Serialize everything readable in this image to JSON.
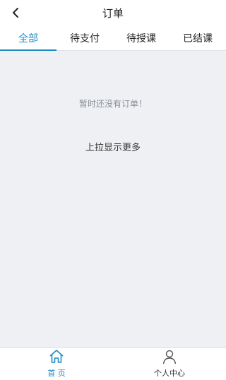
{
  "header": {
    "title": "订单",
    "back_icon": "chevron-left-icon"
  },
  "tabs": [
    {
      "label": "全部",
      "active": true
    },
    {
      "label": "待支付",
      "active": false
    },
    {
      "label": "待授课",
      "active": false
    },
    {
      "label": "已结课",
      "active": false
    }
  ],
  "main": {
    "empty_text": "暂时还没有订单！",
    "load_more_text": "上拉显示更多"
  },
  "tabbar": {
    "items": [
      {
        "label": "首 页",
        "icon": "home-icon",
        "active": true
      },
      {
        "label": "个人中心",
        "icon": "user-icon",
        "active": false
      }
    ]
  },
  "colors": {
    "accent": "#1e8bc3",
    "background": "#eef0f3"
  }
}
